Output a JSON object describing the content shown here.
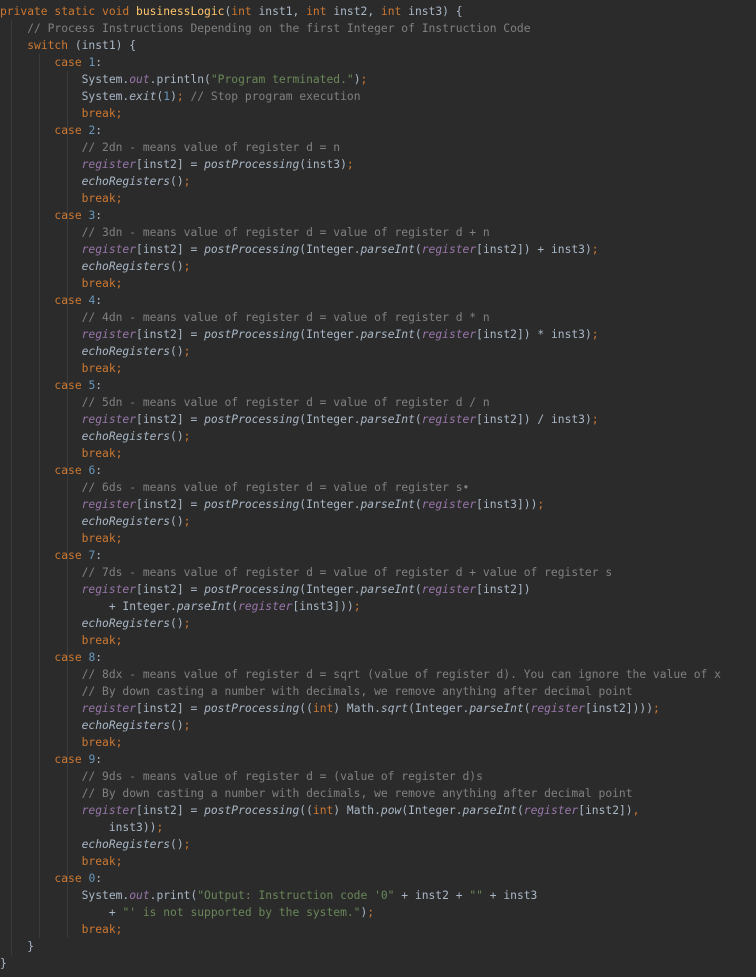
{
  "colors": {
    "background": "#2b2b2b",
    "plain": "#a9b7c6",
    "keyword": "#cc7832",
    "method_declaration": "#ffc66d",
    "number": "#6897bb",
    "string": "#6a8759",
    "comment": "#808080",
    "field": "#9876aa"
  },
  "code_lines": [
    {
      "indent": 0,
      "tokens": [
        [
          "kw",
          "private static void "
        ],
        [
          "fn",
          "businessLogic"
        ],
        [
          "p",
          "("
        ],
        [
          "kw",
          "int "
        ],
        [
          "p",
          "inst1, "
        ],
        [
          "kw",
          "int "
        ],
        [
          "p",
          "inst2, "
        ],
        [
          "kw",
          "int "
        ],
        [
          "p",
          "inst3) {"
        ]
      ]
    },
    {
      "indent": 1,
      "tokens": [
        [
          "cm",
          "// Process Instructions Depending on the first Integer of Instruction Code"
        ]
      ]
    },
    {
      "indent": 1,
      "tokens": [
        [
          "kw",
          "switch "
        ],
        [
          "p",
          "(inst1) {"
        ]
      ]
    },
    {
      "indent": 2,
      "tokens": [
        [
          "kw",
          "case "
        ],
        [
          "num",
          "1"
        ],
        [
          "p",
          ":"
        ]
      ]
    },
    {
      "indent": 3,
      "tokens": [
        [
          "p",
          "System."
        ],
        [
          "field",
          "out"
        ],
        [
          "p",
          ".println("
        ],
        [
          "str",
          "\"Program terminated.\""
        ],
        [
          "p",
          ")"
        ],
        [
          "kw",
          ";"
        ]
      ]
    },
    {
      "indent": 3,
      "tokens": [
        [
          "p",
          "System."
        ],
        [
          "st",
          "exit"
        ],
        [
          "p",
          "("
        ],
        [
          "num",
          "1"
        ],
        [
          "p",
          ")"
        ],
        [
          "kw",
          "; "
        ],
        [
          "cm",
          "// Stop program execution"
        ]
      ]
    },
    {
      "indent": 3,
      "tokens": [
        [
          "kw",
          "break;"
        ]
      ]
    },
    {
      "indent": 2,
      "tokens": [
        [
          "kw",
          "case "
        ],
        [
          "num",
          "2"
        ],
        [
          "p",
          ":"
        ]
      ]
    },
    {
      "indent": 3,
      "tokens": [
        [
          "cm",
          "// 2dn - means value of register d = n"
        ]
      ]
    },
    {
      "indent": 3,
      "tokens": [
        [
          "field",
          "register"
        ],
        [
          "p",
          "[inst2] = "
        ],
        [
          "st",
          "postProcessing"
        ],
        [
          "p",
          "(inst3)"
        ],
        [
          "kw",
          ";"
        ]
      ]
    },
    {
      "indent": 3,
      "tokens": [
        [
          "st",
          "echoRegisters"
        ],
        [
          "p",
          "()"
        ],
        [
          "kw",
          ";"
        ]
      ]
    },
    {
      "indent": 3,
      "tokens": [
        [
          "kw",
          "break;"
        ]
      ]
    },
    {
      "indent": 2,
      "tokens": [
        [
          "kw",
          "case "
        ],
        [
          "num",
          "3"
        ],
        [
          "p",
          ":"
        ]
      ]
    },
    {
      "indent": 3,
      "tokens": [
        [
          "cm",
          "// 3dn - means value of register d = value of register d + n"
        ]
      ]
    },
    {
      "indent": 3,
      "tokens": [
        [
          "field",
          "register"
        ],
        [
          "p",
          "[inst2] = "
        ],
        [
          "st",
          "postProcessing"
        ],
        [
          "p",
          "(Integer."
        ],
        [
          "st",
          "parseInt"
        ],
        [
          "p",
          "("
        ],
        [
          "field",
          "register"
        ],
        [
          "p",
          "[inst2]) + inst3)"
        ],
        [
          "kw",
          ";"
        ]
      ]
    },
    {
      "indent": 3,
      "tokens": [
        [
          "st",
          "echoRegisters"
        ],
        [
          "p",
          "()"
        ],
        [
          "kw",
          ";"
        ]
      ]
    },
    {
      "indent": 3,
      "tokens": [
        [
          "kw",
          "break;"
        ]
      ]
    },
    {
      "indent": 2,
      "tokens": [
        [
          "kw",
          "case "
        ],
        [
          "num",
          "4"
        ],
        [
          "p",
          ":"
        ]
      ]
    },
    {
      "indent": 3,
      "tokens": [
        [
          "cm",
          "// 4dn - means value of register d = value of register d * n"
        ]
      ]
    },
    {
      "indent": 3,
      "tokens": [
        [
          "field",
          "register"
        ],
        [
          "p",
          "[inst2] = "
        ],
        [
          "st",
          "postProcessing"
        ],
        [
          "p",
          "(Integer."
        ],
        [
          "st",
          "parseInt"
        ],
        [
          "p",
          "("
        ],
        [
          "field",
          "register"
        ],
        [
          "p",
          "[inst2]) * inst3)"
        ],
        [
          "kw",
          ";"
        ]
      ]
    },
    {
      "indent": 3,
      "tokens": [
        [
          "st",
          "echoRegisters"
        ],
        [
          "p",
          "()"
        ],
        [
          "kw",
          ";"
        ]
      ]
    },
    {
      "indent": 3,
      "tokens": [
        [
          "kw",
          "break;"
        ]
      ]
    },
    {
      "indent": 2,
      "tokens": [
        [
          "kw",
          "case "
        ],
        [
          "num",
          "5"
        ],
        [
          "p",
          ":"
        ]
      ]
    },
    {
      "indent": 3,
      "tokens": [
        [
          "cm",
          "// 5dn - means value of register d = value of register d / n"
        ]
      ]
    },
    {
      "indent": 3,
      "tokens": [
        [
          "field",
          "register"
        ],
        [
          "p",
          "[inst2] = "
        ],
        [
          "st",
          "postProcessing"
        ],
        [
          "p",
          "(Integer."
        ],
        [
          "st",
          "parseInt"
        ],
        [
          "p",
          "("
        ],
        [
          "field",
          "register"
        ],
        [
          "p",
          "[inst2]) / inst3)"
        ],
        [
          "kw",
          ";"
        ]
      ]
    },
    {
      "indent": 3,
      "tokens": [
        [
          "st",
          "echoRegisters"
        ],
        [
          "p",
          "()"
        ],
        [
          "kw",
          ";"
        ]
      ]
    },
    {
      "indent": 3,
      "tokens": [
        [
          "kw",
          "break;"
        ]
      ]
    },
    {
      "indent": 2,
      "tokens": [
        [
          "kw",
          "case "
        ],
        [
          "num",
          "6"
        ],
        [
          "p",
          ":"
        ]
      ]
    },
    {
      "indent": 3,
      "tokens": [
        [
          "cm",
          "// 6ds - means value of register d = value of register s•"
        ]
      ]
    },
    {
      "indent": 3,
      "tokens": [
        [
          "field",
          "register"
        ],
        [
          "p",
          "[inst2] = "
        ],
        [
          "st",
          "postProcessing"
        ],
        [
          "p",
          "(Integer."
        ],
        [
          "st",
          "parseInt"
        ],
        [
          "p",
          "("
        ],
        [
          "field",
          "register"
        ],
        [
          "p",
          "[inst3]))"
        ],
        [
          "kw",
          ";"
        ]
      ]
    },
    {
      "indent": 3,
      "tokens": [
        [
          "st",
          "echoRegisters"
        ],
        [
          "p",
          "()"
        ],
        [
          "kw",
          ";"
        ]
      ]
    },
    {
      "indent": 3,
      "tokens": [
        [
          "kw",
          "break;"
        ]
      ]
    },
    {
      "indent": 2,
      "tokens": [
        [
          "kw",
          "case "
        ],
        [
          "num",
          "7"
        ],
        [
          "p",
          ":"
        ]
      ]
    },
    {
      "indent": 3,
      "tokens": [
        [
          "cm",
          "// 7ds - means value of register d = value of register d + value of register s"
        ]
      ]
    },
    {
      "indent": 3,
      "tokens": [
        [
          "field",
          "register"
        ],
        [
          "p",
          "[inst2] = "
        ],
        [
          "st",
          "postProcessing"
        ],
        [
          "p",
          "(Integer."
        ],
        [
          "st",
          "parseInt"
        ],
        [
          "p",
          "("
        ],
        [
          "field",
          "register"
        ],
        [
          "p",
          "[inst2])"
        ]
      ]
    },
    {
      "indent": 4,
      "tokens": [
        [
          "p",
          "+ Integer."
        ],
        [
          "st",
          "parseInt"
        ],
        [
          "p",
          "("
        ],
        [
          "field",
          "register"
        ],
        [
          "p",
          "[inst3]))"
        ],
        [
          "kw",
          ";"
        ]
      ]
    },
    {
      "indent": 3,
      "tokens": [
        [
          "st",
          "echoRegisters"
        ],
        [
          "p",
          "()"
        ],
        [
          "kw",
          ";"
        ]
      ]
    },
    {
      "indent": 3,
      "tokens": [
        [
          "kw",
          "break;"
        ]
      ]
    },
    {
      "indent": 2,
      "tokens": [
        [
          "kw",
          "case "
        ],
        [
          "num",
          "8"
        ],
        [
          "p",
          ":"
        ]
      ]
    },
    {
      "indent": 3,
      "tokens": [
        [
          "cm",
          "// 8dx - means value of register d = sqrt (value of register d). You can ignore the value of x"
        ]
      ]
    },
    {
      "indent": 3,
      "tokens": [
        [
          "cm",
          "// By down casting a number with decimals, we remove anything after decimal point"
        ]
      ]
    },
    {
      "indent": 3,
      "tokens": [
        [
          "field",
          "register"
        ],
        [
          "p",
          "[inst2] = "
        ],
        [
          "st",
          "postProcessing"
        ],
        [
          "p",
          "(("
        ],
        [
          "kw",
          "int"
        ],
        [
          "p",
          ") Math."
        ],
        [
          "st",
          "sqrt"
        ],
        [
          "p",
          "(Integer."
        ],
        [
          "st",
          "parseInt"
        ],
        [
          "p",
          "("
        ],
        [
          "field",
          "register"
        ],
        [
          "p",
          "[inst2])))"
        ],
        [
          "kw",
          ";"
        ]
      ]
    },
    {
      "indent": 3,
      "tokens": [
        [
          "st",
          "echoRegisters"
        ],
        [
          "p",
          "()"
        ],
        [
          "kw",
          ";"
        ]
      ]
    },
    {
      "indent": 3,
      "tokens": [
        [
          "kw",
          "break;"
        ]
      ]
    },
    {
      "indent": 2,
      "tokens": [
        [
          "kw",
          "case "
        ],
        [
          "num",
          "9"
        ],
        [
          "p",
          ":"
        ]
      ]
    },
    {
      "indent": 3,
      "tokens": [
        [
          "cm",
          "// 9ds - means value of register d = (value of register d)s"
        ]
      ]
    },
    {
      "indent": 3,
      "tokens": [
        [
          "cm",
          "// By down casting a number with decimals, we remove anything after decimal point"
        ]
      ]
    },
    {
      "indent": 3,
      "tokens": [
        [
          "field",
          "register"
        ],
        [
          "p",
          "[inst2] = "
        ],
        [
          "st",
          "postProcessing"
        ],
        [
          "p",
          "(("
        ],
        [
          "kw",
          "int"
        ],
        [
          "p",
          ") Math."
        ],
        [
          "st",
          "pow"
        ],
        [
          "p",
          "(Integer."
        ],
        [
          "st",
          "parseInt"
        ],
        [
          "p",
          "("
        ],
        [
          "field",
          "register"
        ],
        [
          "p",
          "[inst2])"
        ],
        [
          "kw",
          ","
        ]
      ]
    },
    {
      "indent": 4,
      "tokens": [
        [
          "p",
          "inst3))"
        ],
        [
          "kw",
          ";"
        ]
      ]
    },
    {
      "indent": 3,
      "tokens": [
        [
          "st",
          "echoRegisters"
        ],
        [
          "p",
          "()"
        ],
        [
          "kw",
          ";"
        ]
      ]
    },
    {
      "indent": 3,
      "tokens": [
        [
          "kw",
          "break;"
        ]
      ]
    },
    {
      "indent": 2,
      "tokens": [
        [
          "kw",
          "case "
        ],
        [
          "num",
          "0"
        ],
        [
          "p",
          ":"
        ]
      ]
    },
    {
      "indent": 3,
      "tokens": [
        [
          "p",
          "System."
        ],
        [
          "field",
          "out"
        ],
        [
          "p",
          ".print("
        ],
        [
          "str",
          "\"Output: Instruction code '0\""
        ],
        [
          "p",
          " + inst2 + "
        ],
        [
          "str",
          "\"\""
        ],
        [
          "p",
          " + inst3"
        ]
      ]
    },
    {
      "indent": 4,
      "tokens": [
        [
          "p",
          "+ "
        ],
        [
          "str",
          "\"' is not supported by the system.\""
        ],
        [
          "p",
          ")"
        ],
        [
          "kw",
          ";"
        ]
      ]
    },
    {
      "indent": 3,
      "tokens": [
        [
          "kw",
          "break;"
        ]
      ]
    },
    {
      "indent": 1,
      "tokens": [
        [
          "p",
          "}"
        ]
      ]
    },
    {
      "indent": 0,
      "tokens": [
        [
          "p",
          "}"
        ]
      ]
    }
  ]
}
